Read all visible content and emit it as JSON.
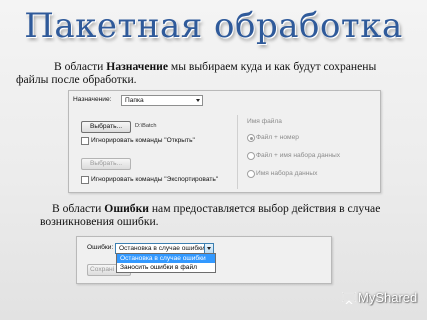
{
  "slide": {
    "title": "Пакетная обработка",
    "p1_pre": "В области ",
    "p1_bold": "Назначение",
    "p1_post": " мы выбираем куда и как будут сохранены",
    "p1_line2": "файлы после обработки.",
    "p2_pre": "В области ",
    "p2_bold": "Ошибки",
    "p2_post": " нам предоставляется выбор действия в случае",
    "p2_line2": "возникновения ошибки."
  },
  "dest_dialog": {
    "dest_label": "Назначение:",
    "dest_value": "Папка",
    "choose_button": "Выбрать...",
    "path_text": "D:\\Batch",
    "ignore_open_label": "Игнорировать команды \"Открыть\"",
    "choose_button2": "Выбрать...",
    "ignore_export_label": "Игнорировать команды \"Экспортировать\"",
    "file_name_heading": "Имя файла",
    "radio_1": "Файл + номер",
    "radio_2": "Файл + имя набора данных",
    "radio_3": "Имя набора данных"
  },
  "errors_dialog": {
    "errors_label": "Ошибки:",
    "errors_value": "Остановка в случае ошибки",
    "save_as_partial": "Сохрані",
    "options": [
      "Остановка в случае ошибки",
      "Заносить ошибки в файл"
    ]
  },
  "watermark": {
    "brand": "MyShared"
  }
}
